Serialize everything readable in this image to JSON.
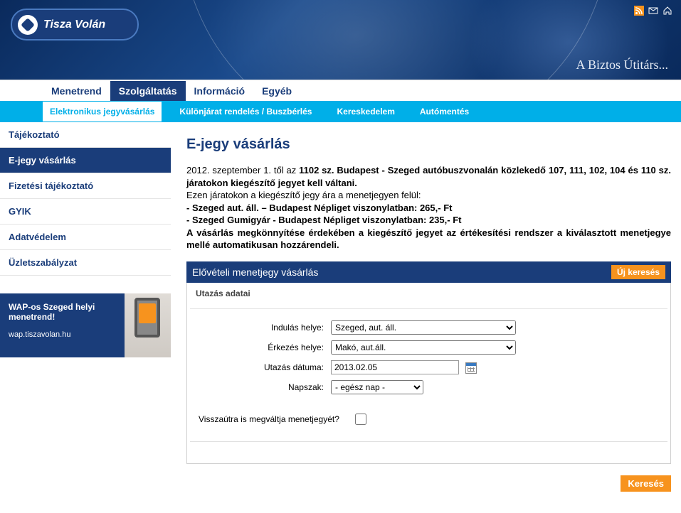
{
  "brand": "Tisza Volán",
  "slogan": "A Biztos Útitárs...",
  "top_icons": [
    "rss-icon",
    "mail-icon",
    "home-icon"
  ],
  "nav": {
    "items": [
      {
        "label": "Menetrend",
        "active": false
      },
      {
        "label": "Szolgáltatás",
        "active": true
      },
      {
        "label": "Információ",
        "active": false
      },
      {
        "label": "Egyéb",
        "active": false
      }
    ]
  },
  "subnav": {
    "items": [
      {
        "label": "Elektronikus jegyvásárlás",
        "active": true
      },
      {
        "label": "Különjárat rendelés / Buszbérlés",
        "active": false
      },
      {
        "label": "Kereskedelem",
        "active": false
      },
      {
        "label": "Autómentés",
        "active": false
      }
    ]
  },
  "sidebar": {
    "items": [
      {
        "label": "Tájékoztató",
        "active": false
      },
      {
        "label": "E-jegy vásárlás",
        "active": true
      },
      {
        "label": "Fizetési tájékoztató",
        "active": false
      },
      {
        "label": "GYIK",
        "active": false
      },
      {
        "label": "Adatvédelem",
        "active": false
      },
      {
        "label": "Üzletszabályzat",
        "active": false
      }
    ]
  },
  "wap": {
    "line1": "WAP-os Szeged helyi menetrend!",
    "url": "wap.tiszavolan.hu"
  },
  "page": {
    "title": "E-jegy vásárlás",
    "intro_prefix": "2012. szeptember 1. től az ",
    "intro_bold1": "1102 sz. Budapest - Szeged autóbuszvonalán közlekedő 107, 111, 102, 104 és 110 sz. járatokon kiegészítő jegyet kell váltani.",
    "intro_line2": "Ezen járatokon a kiegészítő jegy ára a menetjegyen felül:",
    "intro_bold2": "- Szeged aut. áll. – Budapest Népliget viszonylatban: 265,- Ft",
    "intro_bold3": "- Szeged Gumigyár - Budapest Népliget viszonylatban: 235,- Ft",
    "intro_bold4": "A vásárlás megkönnyítése érdekében a kiegészítő jegyet az értékesítési rendszer a kiválasztott menetjegye mellé automatikusan hozzárendeli.",
    "section_title": "Elővételi menetjegy vásárlás",
    "new_search": "Új keresés",
    "panel_subtitle": "Utazás adatai"
  },
  "form": {
    "dep_label": "Indulás helye:",
    "dep_value": "Szeged, aut. áll.",
    "arr_label": "Érkezés helye:",
    "arr_value": "Makó, aut.áll.",
    "date_label": "Utazás dátuma:",
    "date_value": "2013.02.05",
    "daypart_label": "Napszak:",
    "daypart_value": "- egész nap -",
    "return_label": "Visszaútra is megváltja menetjegyét?",
    "search_btn": "Keresés"
  }
}
